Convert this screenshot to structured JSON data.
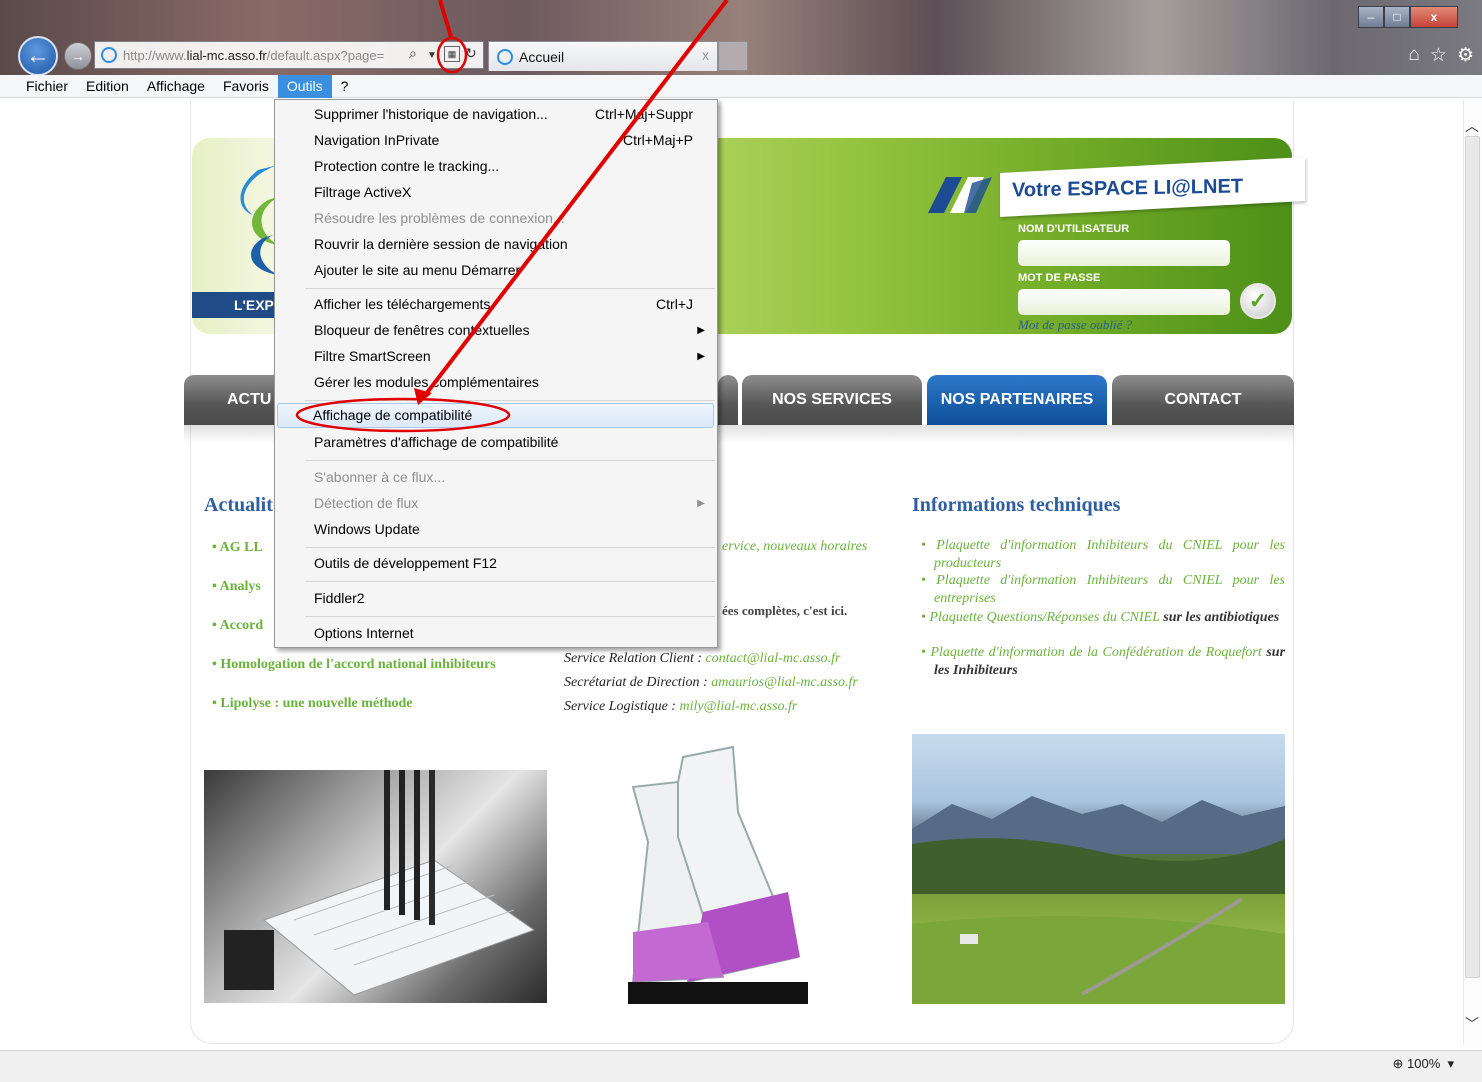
{
  "window": {
    "min_label": "–",
    "max_label": "□",
    "close_label": "x"
  },
  "nav_buttons": {
    "back": "←",
    "forward": "→"
  },
  "address": {
    "prefix": "http://www.",
    "domain": "lial-mc.asso.fr",
    "path": "/default.aspx?page="
  },
  "tab": {
    "title": "Accueil",
    "close": "x"
  },
  "menubar": [
    "Fichier",
    "Edition",
    "Affichage",
    "Favoris",
    "Outils",
    "?"
  ],
  "dropdown": {
    "items": [
      {
        "label": "Supprimer l'historique de navigation...",
        "shortcut": "Ctrl+Maj+Suppr"
      },
      {
        "label": "Navigation InPrivate",
        "shortcut": "Ctrl+Maj+P"
      },
      {
        "label": "Protection contre le tracking..."
      },
      {
        "label": "Filtrage ActiveX"
      },
      {
        "label": "Résoudre les problèmes de connexion..."
      },
      {
        "label": "Rouvrir la dernière session de navigation"
      },
      {
        "label": "Ajouter le site au menu Démarrer"
      },
      {
        "label": "Afficher les téléchargements",
        "shortcut": "Ctrl+J"
      },
      {
        "label": "Bloqueur de fenêtres contextuelles"
      },
      {
        "label": "Filtre SmartScreen"
      },
      {
        "label": "Gérer les modules complémentaires"
      },
      {
        "label": "Affichage de compatibilité"
      },
      {
        "label": "Paramètres d'affichage de compatibilité"
      },
      {
        "label": "S'abonner à ce flux..."
      },
      {
        "label": "Détection de flux"
      },
      {
        "label": "Windows Update"
      },
      {
        "label": "Outils de développement F12"
      },
      {
        "label": "Fiddler2"
      },
      {
        "label": "Options Internet"
      }
    ]
  },
  "banner": {
    "tagline": "L'EXP",
    "title": "Votre ESPACE LI@LNET",
    "username_label": "NOM D'UTILISATEUR",
    "password_label": "MOT DE PASSE",
    "forgot": "Mot de passe oublié ?"
  },
  "nav": [
    "ACTU",
    "NOS SERVICES",
    "NOS PARTENAIRES",
    "CONTACT"
  ],
  "news": {
    "title": "Actualit",
    "items": [
      "AG LL",
      "Analys",
      "Accord",
      "Homologation de l'accord national inhibiteurs",
      "Lipolyse : une nouvelle méthode"
    ]
  },
  "middle": {
    "frag1": "ervice,  nouveaux  horaires",
    "frag2": "ées complètes, c'est ici.",
    "services": [
      {
        "label": "Service Relation Client :",
        "email": "contact@lial-mc.asso.fr"
      },
      {
        "label": "Secrétariat de Direction :",
        "email": "amaurios@lial-mc.asso.fr"
      },
      {
        "label": "Service Logistique :",
        "email": "mily@lial-mc.asso.fr"
      }
    ]
  },
  "tech": {
    "title": "Informations techniques",
    "item1": "Plaquette d'information Inhibiteurs du CNIEL pour les producteurs",
    "item2": "Plaquette d'information Inhibiteurs du CNIEL pour les entreprises",
    "item3a": "Plaquette Questions/Réponses du CNIEL",
    "item3b": "sur les antibiotiques",
    "item4a": "Plaquette d'information de la Confédération de Roquefort",
    "item4b": "sur les Inhibiteurs"
  },
  "status": {
    "zoom": "100%"
  },
  "colors": {
    "accent_blue": "#1c4b93",
    "green_link": "#6ab33b",
    "menu_active": "#3a8fe0",
    "annotation_red": "#e00000"
  },
  "icons": {
    "home": "home-icon",
    "favorites": "star-icon",
    "tools": "gear-icon",
    "search": "search-icon",
    "compat": "compatibility-view-icon",
    "refresh": "refresh-icon"
  }
}
